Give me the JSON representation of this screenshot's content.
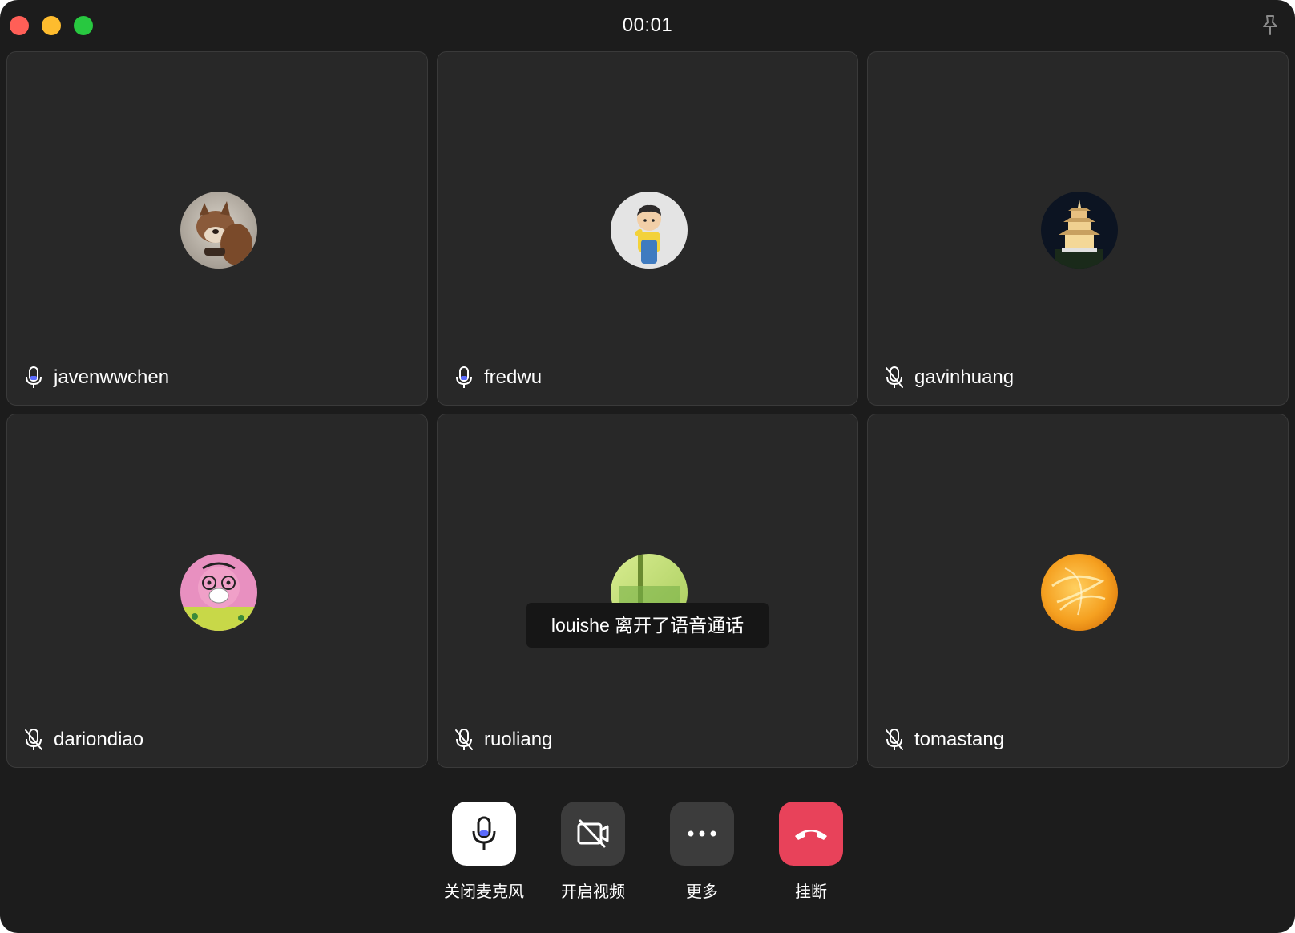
{
  "window": {
    "timer": "00:01"
  },
  "participants": [
    {
      "name": "javenwwchen",
      "mic": "on",
      "avatar": "shiba-dog-photo"
    },
    {
      "name": "fredwu",
      "mic": "on",
      "avatar": "cartoon-boy"
    },
    {
      "name": "gavinhuang",
      "mic": "muted",
      "avatar": "pagoda-night"
    },
    {
      "name": "dariondiao",
      "mic": "muted",
      "avatar": "pink-cartoon-mask"
    },
    {
      "name": "ruoliang",
      "mic": "muted",
      "avatar": "green-sign"
    },
    {
      "name": "tomastang",
      "mic": "muted",
      "avatar": "orange-abstract"
    }
  ],
  "toast": {
    "text": "louishe 离开了语音通话"
  },
  "controls": {
    "mute_label": "关闭麦克风",
    "video_label": "开启视频",
    "more_label": "更多",
    "hangup_label": "挂断"
  },
  "colors": {
    "window_bg": "#1c1c1c",
    "tile_bg": "#282828",
    "hangup": "#e8425a",
    "mic_active": "#5b6bff"
  }
}
